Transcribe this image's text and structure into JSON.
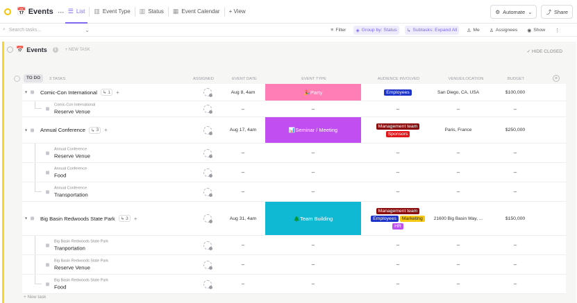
{
  "header": {
    "title": "Events",
    "tabs": [
      {
        "label": "List",
        "icon": "list-icon",
        "active": true
      },
      {
        "label": "Event Type",
        "icon": "board-icon",
        "active": false
      },
      {
        "label": "Status",
        "icon": "board-icon",
        "active": false
      },
      {
        "label": "Event Calendar",
        "icon": "calendar-icon",
        "active": false
      }
    ],
    "add_view": "+ View",
    "automate": "Automate",
    "share": "Share"
  },
  "toolbar": {
    "search_placeholder": "Search tasks...",
    "filter": "Filter",
    "group_by": "Group by: Status",
    "subtasks": "Subtasks: Expand All",
    "me": "Me",
    "assignees": "Assignees",
    "show": "Show"
  },
  "list": {
    "title": "Events",
    "new_task": "+ NEW TASK",
    "hide_closed": "HIDE CLOSED",
    "new_task_bottom": "+ New task"
  },
  "group": {
    "status": "TO DO",
    "count": "3 TASKS"
  },
  "columns": {
    "assigned": "ASSIGNED",
    "event_date": "EVENT DATE",
    "event_type": "EVENT TYPE",
    "audience": "AUDIENCE INVOLVED",
    "venue": "VENUE/LOCATION",
    "budget": "BUDGET"
  },
  "dash": "–",
  "rows": [
    {
      "kind": "task",
      "height": 25,
      "name": "Comic-Con International",
      "subtasks": "1",
      "date": "Aug 8, 4am",
      "event_type": "🎉Party",
      "event_color": "#ff7eb6",
      "audience": [
        [
          "Employees"
        ]
      ],
      "audience_colors": [
        [
          "#1d33c9"
        ]
      ],
      "venue": "San Diego, CA, USA",
      "budget": "$100,000"
    },
    {
      "kind": "sub",
      "height": 23,
      "parent": "Comic-Con International",
      "name": "Reserve Venue",
      "last": true
    },
    {
      "kind": "task",
      "height": 38,
      "name": "Annual Conference",
      "subtasks": "3",
      "date": "Aug 17, 4am",
      "event_type": "📊Seminar / Meeting",
      "event_color": "#c04ef0",
      "audience": [
        [
          "Management team"
        ],
        [
          "Sponsors"
        ]
      ],
      "audience_colors": [
        [
          "#8b0e0e"
        ],
        [
          "#e0161b"
        ]
      ],
      "venue": "Paris, France",
      "budget": "$250,000"
    },
    {
      "kind": "sub",
      "height": 28,
      "parent": "Annual Conference",
      "name": "Reserve Venue",
      "last": false
    },
    {
      "kind": "sub",
      "height": 28,
      "parent": "Annual Conference",
      "name": "Food",
      "last": false
    },
    {
      "kind": "sub",
      "height": 28,
      "parent": "Annual Conference",
      "name": "Transportation",
      "last": true
    },
    {
      "kind": "task",
      "height": 49,
      "name": "Big Basin Redwoods State Park",
      "subtasks": "3",
      "date": "Aug 31, 4am",
      "event_type": "🌲Team Building",
      "event_color": "#0fb9d4",
      "audience": [
        [
          "Management team"
        ],
        [
          "Employees",
          "Marketing"
        ],
        [
          "HR"
        ]
      ],
      "audience_colors": [
        [
          "#8b0e0e"
        ],
        [
          "#1d33c9",
          "#f6c915"
        ],
        [
          "#c04ef0"
        ]
      ],
      "venue": "21600 Big Basin Way, ...",
      "budget": "$150,000"
    },
    {
      "kind": "sub",
      "height": 28,
      "parent": "Big Basin Redwoods State Park",
      "name": "Tranportation",
      "last": false
    },
    {
      "kind": "sub",
      "height": 28,
      "parent": "Big Basin Redwoods State Park",
      "name": "Reserve Venue",
      "last": false
    },
    {
      "kind": "sub",
      "height": 28,
      "parent": "Big Basin Redwoods State Park",
      "name": "Food",
      "last": true
    }
  ]
}
